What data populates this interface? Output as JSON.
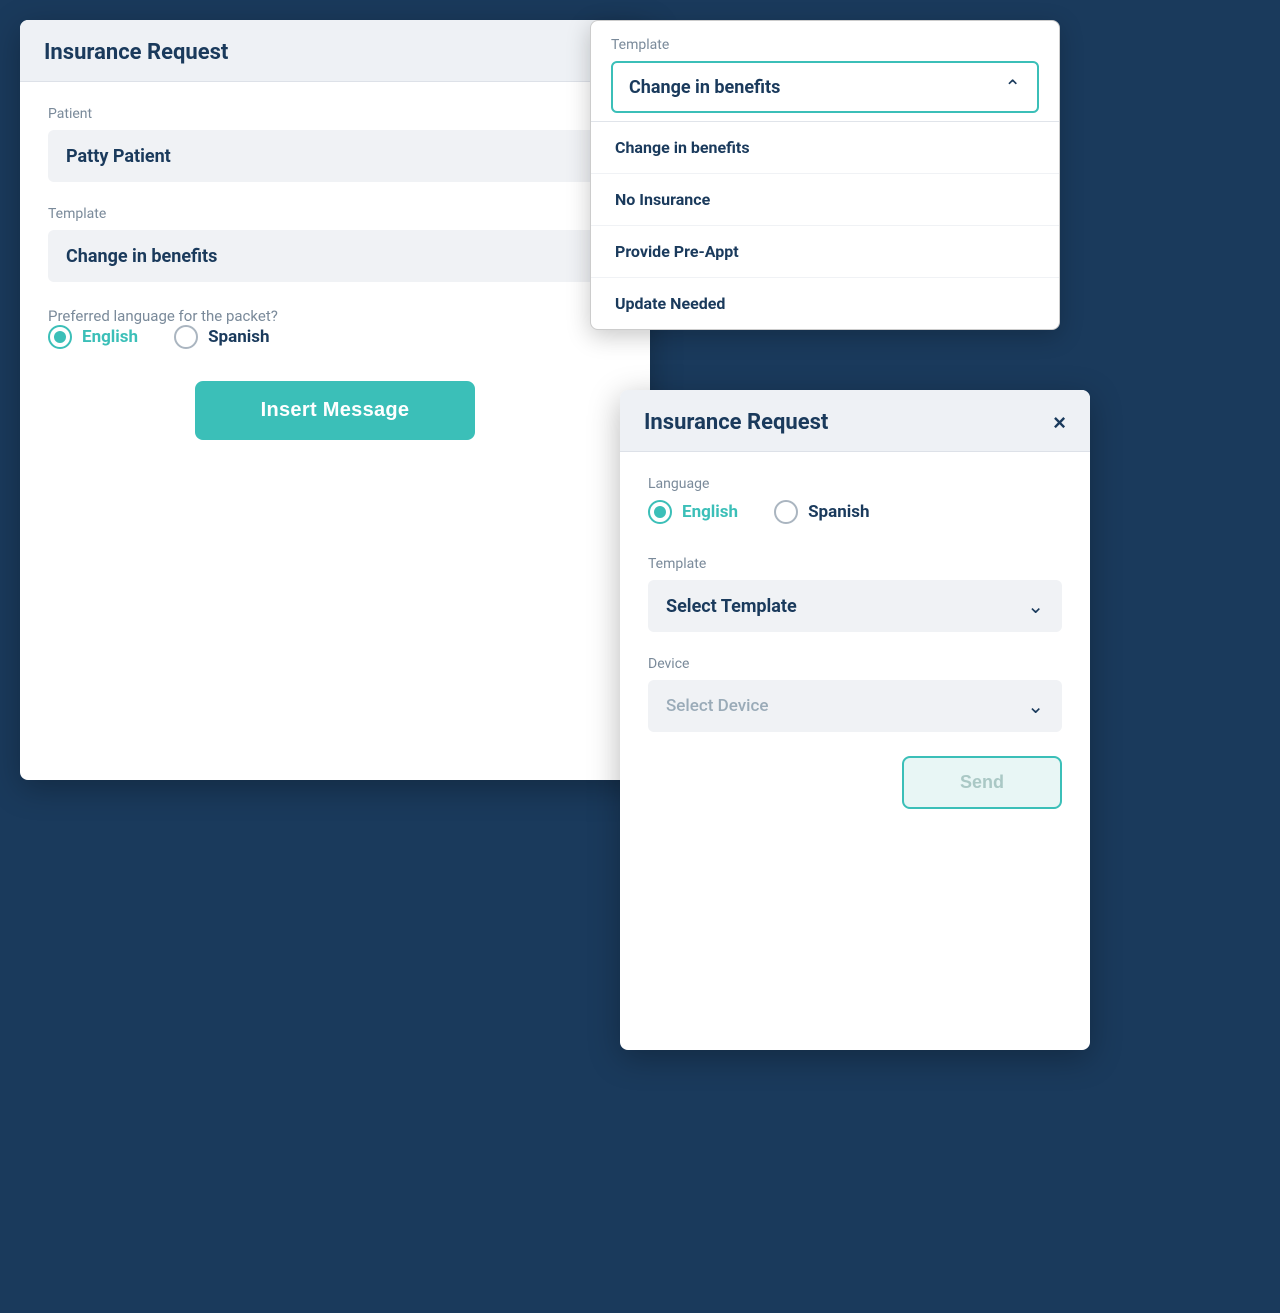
{
  "modal1": {
    "title": "Insurance Request",
    "close": "×",
    "patient_label": "Patient",
    "patient_value": "Patty Patient",
    "template_label": "Template",
    "template_value": "Change in benefits",
    "language_question": "Preferred language for the packet?",
    "language_english": "English",
    "language_spanish": "Spanish",
    "insert_button": "Insert Message"
  },
  "modal2": {
    "template_label": "Template",
    "template_selected": "Change in benefits",
    "options": [
      "Change in benefits",
      "No Insurance",
      "Provide Pre-Appt",
      "Update Needed"
    ]
  },
  "modal3": {
    "title": "Insurance Request",
    "close": "×",
    "language_label": "Language",
    "language_english": "English",
    "language_spanish": "Spanish",
    "template_label": "Template",
    "template_placeholder": "Select Template",
    "device_label": "Device",
    "device_placeholder": "Select Device",
    "send_button": "Send"
  }
}
